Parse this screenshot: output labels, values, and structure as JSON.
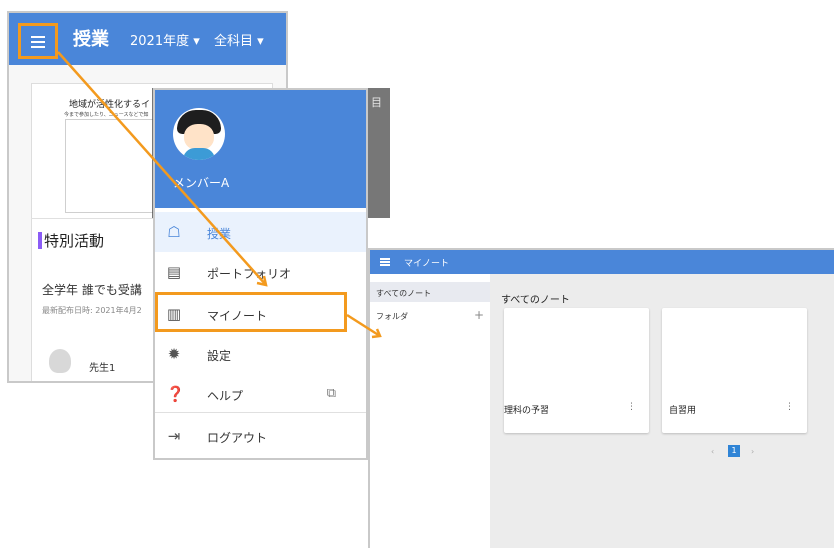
{
  "screen1": {
    "title": "授業",
    "year_dropdown": "2021年度 ▾",
    "subject_dropdown": "全科目 ▾",
    "thumbnail_title": "地域が活性化するイ",
    "thumbnail_subtitle": "今まで参加したり、ニュースなどで知",
    "section_title": "特別活動",
    "class_name": "全学年 誰でも受講",
    "last_distributed": "最新配布日時: 2021年4月2",
    "teacher": "先生1"
  },
  "dimmed_label": "目",
  "drawer": {
    "user_name": "メンバーA",
    "items": [
      {
        "icon": "presentation-icon",
        "label": "授業"
      },
      {
        "icon": "portfolio-icon",
        "label": "ポートフォリオ"
      },
      {
        "icon": "notebook-icon",
        "label": "マイノート"
      },
      {
        "icon": "gear-icon",
        "label": "設定"
      },
      {
        "icon": "help-icon",
        "label": "ヘルプ"
      },
      {
        "icon": "logout-icon",
        "label": "ログアウト"
      }
    ]
  },
  "mynote": {
    "title": "マイノート",
    "sidebar": {
      "all_notes": "すべてのノート",
      "folder": "フォルダ",
      "add": "+"
    },
    "heading": "すべてのノート",
    "notes": [
      {
        "name": "理科の予習",
        "menu": "⋮"
      },
      {
        "name": "自習用",
        "menu": "⋮"
      }
    ],
    "pagination": {
      "prev": "‹",
      "current": "1",
      "next": "›"
    }
  },
  "colors": {
    "primary": "#4a86d9",
    "highlight": "#f39a1e",
    "accent": "#8b5cf6"
  }
}
